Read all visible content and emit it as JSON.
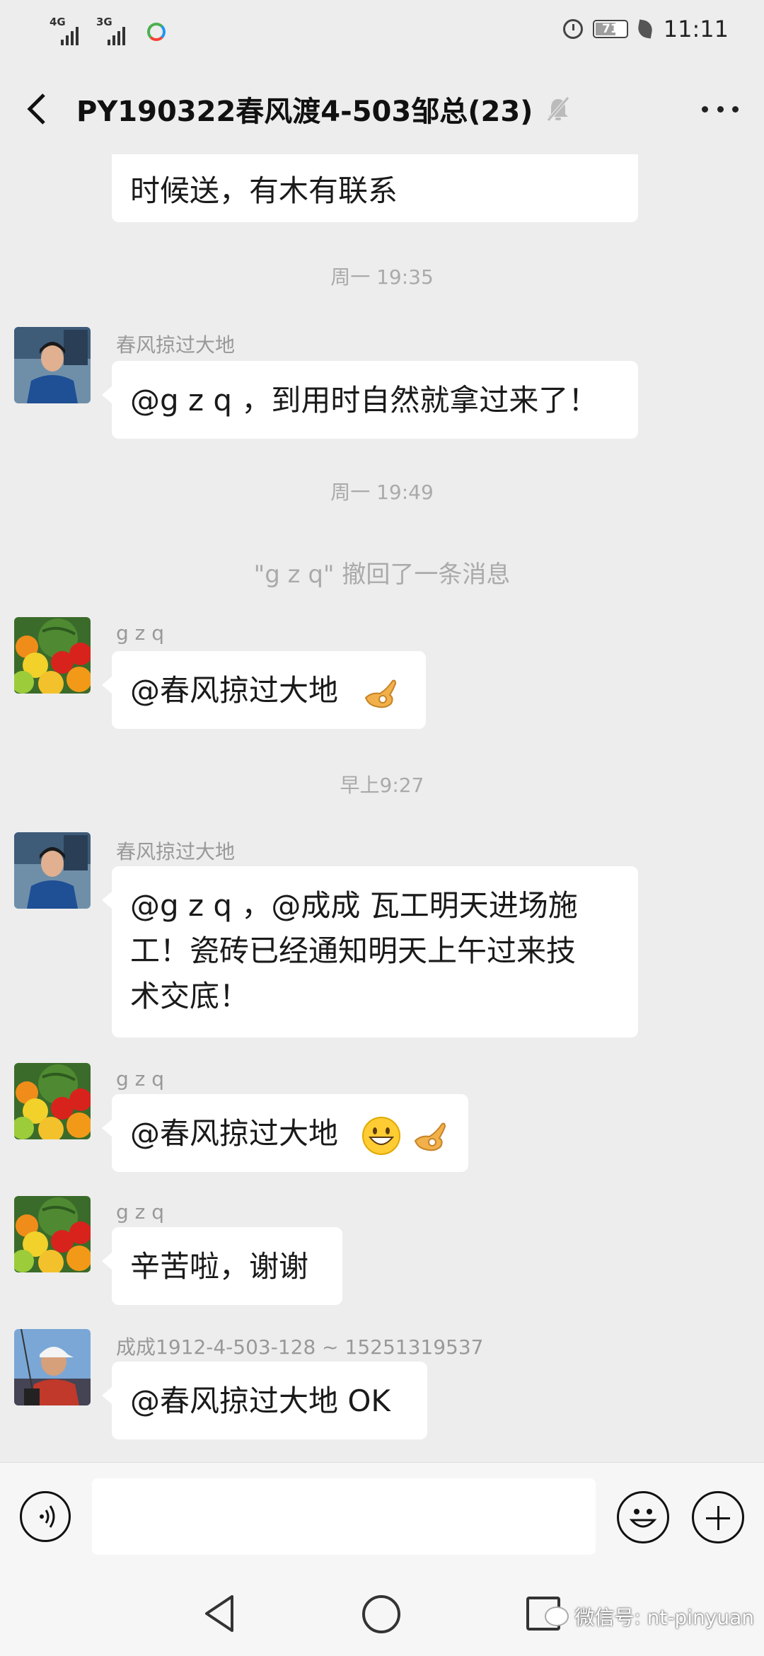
{
  "status_bar": {
    "net1": "4G",
    "net2": "3G",
    "battery": "71",
    "battery_level": 0.71,
    "time": "11:11"
  },
  "header": {
    "title": "PY190322春风渡4-503邹总(23)",
    "muted": true
  },
  "messages": [
    {
      "type": "text",
      "text": "时候送，有木有联系"
    },
    {
      "type": "time",
      "text": "周一 19:35"
    },
    {
      "type": "text",
      "sender": "春风掠过大地",
      "avatar": "man-portrait",
      "text": "@g z q ，到用时自然就拿过来了！"
    },
    {
      "type": "time",
      "text": "周一 19:49"
    },
    {
      "type": "system",
      "text": "\"g z q\" 撤回了一条消息"
    },
    {
      "type": "text",
      "sender": "g z q",
      "avatar": "fruit",
      "text": "@春风掠过大地",
      "emoji": [
        "ok-hand"
      ]
    },
    {
      "type": "time",
      "text": "早上9:27"
    },
    {
      "type": "text",
      "sender": "春风掠过大地",
      "avatar": "man-portrait",
      "lines": [
        "@g z q ，@成成  瓦工明天进场施",
        "工！瓷砖已经通知明天上午过来技",
        "术交底！"
      ]
    },
    {
      "type": "text",
      "sender": "g z q",
      "avatar": "fruit",
      "text": "@春风掠过大地",
      "emoji": [
        "grin",
        "ok-hand"
      ]
    },
    {
      "type": "text",
      "sender": "g z q",
      "avatar": "fruit",
      "text": "辛苦啦，谢谢"
    },
    {
      "type": "text",
      "sender": "成成1912-4-503-128 ~ 15251319537",
      "avatar": "man-cap",
      "text": "@春风掠过大地  OK"
    }
  ],
  "watermark": "微信号: nt-pinyuan",
  "colors": {
    "background": "#ededed",
    "bubble": "#ffffff",
    "meta_text": "#aaaaaa"
  }
}
